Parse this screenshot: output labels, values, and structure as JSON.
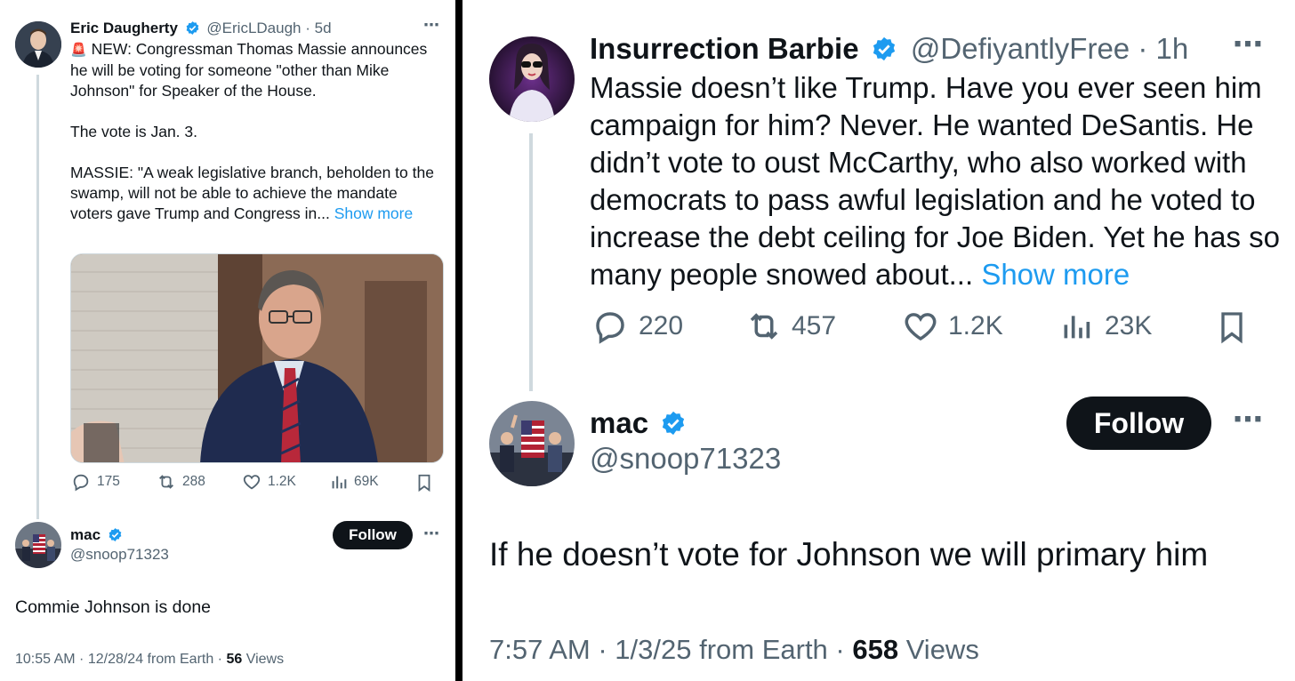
{
  "left": {
    "original": {
      "display_name": "Eric Daugherty",
      "handle": "@EricLDaugh",
      "separator": "·",
      "time": "5d",
      "line1": "NEW: Congressman Thomas Massie announces he will be voting for someone \"other than Mike Johnson\" for Speaker of the House.",
      "line2": "The vote is Jan. 3.",
      "line3": "MASSIE: \"A weak legislative branch, beholden to the swamp, will not be able to achieve the mandate voters gave Trump and Congress in...",
      "show_more": "Show more",
      "replies": "175",
      "reposts": "288",
      "likes": "1.2K",
      "views": "69K"
    },
    "reply": {
      "display_name": "mac",
      "handle": "@snoop71323",
      "follow_label": "Follow",
      "text": "Commie Johnson is done",
      "time": "10:55 AM · 12/28/24 from Earth · ",
      "views_count": "56",
      "views_label": " Views"
    }
  },
  "right": {
    "original": {
      "display_name": "Insurrection Barbie",
      "handle": "@DefiyantlyFree",
      "separator": "·",
      "time": "1h",
      "text": "Massie doesn’t like Trump. Have you ever seen him campaign for him? Never. He wanted DeSantis. He didn’t vote to oust McCarthy, who also worked with democrats to pass awful legislation and he voted to increase the debt ceiling for Joe Biden. Yet he has so many people snowed about...",
      "show_more": "Show more",
      "replies": "220",
      "reposts": "457",
      "likes": "1.2K",
      "views": "23K"
    },
    "reply": {
      "display_name": "mac",
      "handle": "@snoop71323",
      "follow_label": "Follow",
      "text": "If he doesn’t vote for Johnson we will primary him",
      "time": "7:57 AM · 1/3/25 from Earth · ",
      "views_count": "658",
      "views_label": " Views"
    }
  },
  "icons": {
    "more": "⋯",
    "siren": "🚨"
  },
  "colors": {
    "accent": "#1d9bf0",
    "text": "#0f1419",
    "secondary": "#536471",
    "thread_line": "#cfd9de",
    "button": "#0f1419"
  }
}
